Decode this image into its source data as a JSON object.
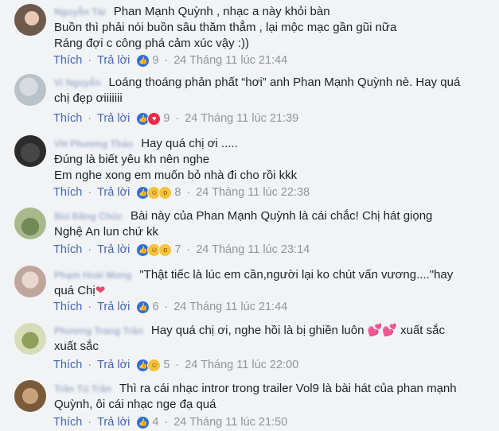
{
  "ui": {
    "like": "Thích",
    "reply": "Trả lời",
    "separator": "·"
  },
  "comments": [
    {
      "author": "Nguyễn Tài",
      "lines": [
        "Phan Mạnh Quỳnh , nhạc a này khỏi bàn",
        "Buồn thì phải nói buồn sâu thăm thẳm , lại mộc mạc gần gũi nữa",
        "Ráng đợi c công phá cảm xúc vậy :))"
      ],
      "reactions": [
        "like-icon"
      ],
      "count": "9",
      "time": "24 Tháng 11 lúc 21:44"
    },
    {
      "author": "Vi Nguyễn",
      "lines": [
        "Loáng thoáng phản phất “hơi” anh Phan Mạnh Quỳnh nè. Hay quá",
        "chị đẹp ơiiiiiii"
      ],
      "reactions": [
        "like-icon",
        "love-icon"
      ],
      "count": "9",
      "time": "24 Tháng 11 lúc 21:39"
    },
    {
      "author": "VH Phương Thảo",
      "lines": [
        "Hay quá chị ơi .....",
        "Đúng là biết yêu kh nên nghe",
        "Em nghe xong em muốn bỏ nhà đi cho rồi kkk"
      ],
      "reactions": [
        "like-icon",
        "haha-icon",
        "wow-icon"
      ],
      "count": "8",
      "time": "24 Tháng 11 lúc 22:38"
    },
    {
      "author": "Bùi Đăng Chúc",
      "lines": [
        "Bài này của Phan Mạnh Quỳnh là cái chắc! Chị hát giọng",
        "Nghệ An lun chứ kk"
      ],
      "reactions": [
        "like-icon",
        "haha-icon",
        "wow-icon"
      ],
      "count": "7",
      "time": "24 Tháng 11 lúc 23:14"
    },
    {
      "author": "Phạm Hoài Mong",
      "lines": [
        "\"Thật tiếc là lúc em cần,người lại ko chút vấn vương....\"hay",
        "quá Chị"
      ],
      "heart": "❤",
      "reactions": [
        "like-icon"
      ],
      "count": "6",
      "time": "24 Tháng 11 lúc 21:44"
    },
    {
      "author": "Phương Trang Trần",
      "lines": [
        "Hay quá chị ơi, nghe hồi là bị ghiền luôn 💕💕 xuất sắc",
        "xuất sắc"
      ],
      "reactions": [
        "like-icon",
        "haha-icon"
      ],
      "count": "5",
      "time": "24 Tháng 11 lúc 22:00"
    },
    {
      "author": "Trần Tú Trần",
      "lines": [
        "Thì ra cái nhạc intror trong trailer Vol9 là bài hát của phan mạnh",
        "Quỳnh, ôi cái nhạc nge đạ quá"
      ],
      "reactions": [
        "like-icon"
      ],
      "count": "4",
      "time": "24 Tháng 11 lúc 21:50"
    }
  ]
}
